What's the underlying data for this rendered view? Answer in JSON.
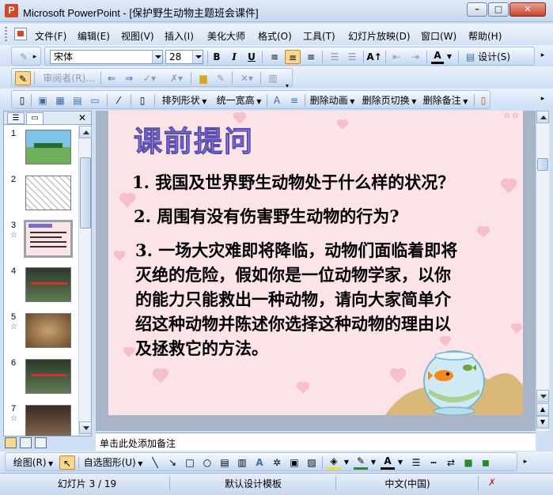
{
  "window": {
    "app_name": "Microsoft PowerPoint",
    "title": "Microsoft PowerPoint - [保护野生动物主题班会课件]",
    "minimize_label": "–",
    "maximize_label": "□",
    "close_label": "✕"
  },
  "menu": {
    "items": [
      "文件(F)",
      "编辑(E)",
      "视图(V)",
      "插入(I)",
      "美化大师",
      "格式(O)",
      "工具(T)",
      "幻灯片放映(D)",
      "窗口(W)",
      "帮助(H)"
    ]
  },
  "formatting": {
    "font_name": "宋体",
    "font_size": "28",
    "bold": "B",
    "italic": "I",
    "underline": "U",
    "design_label": "设计(S)",
    "font_color_label": "A"
  },
  "reviewing": {
    "reviewers_label": "审阅者(R)..."
  },
  "beautify": {
    "arrange_label": "排列形状",
    "uniform_width_label": "统一宽高",
    "delete_anim_label": "删除动画",
    "delete_transition_label": "删除页切换",
    "delete_notes_label": "删除备注"
  },
  "slide_panel": {
    "tab_outline": "outline-icon",
    "tab_slides": "slides-icon",
    "close": "✕",
    "slides": [
      {
        "num": "1",
        "star": ""
      },
      {
        "num": "2",
        "star": ""
      },
      {
        "num": "3",
        "star": "☆"
      },
      {
        "num": "4",
        "star": ""
      },
      {
        "num": "5",
        "star": "☆"
      },
      {
        "num": "6",
        "star": ""
      },
      {
        "num": "7",
        "star": "☆"
      }
    ]
  },
  "slide": {
    "title": "课前提问",
    "q1": "1. 我国及世界野生动物处于什么样的状况？",
    "q2": "2. 周围有没有伤害野生动物的行为?",
    "q3_l1": "3. 一场大灾难即将降临，动物们面临着即将",
    "q3_l2": "灭绝的危险，假如你是一位动物学家，以你",
    "q3_l3": "的能力只能救出一种动物，请向大家简单介",
    "q3_l4": "绍这种动物并陈述你选择这种动物的理由以",
    "q3_l5": "及拯救它的方法。"
  },
  "notes": {
    "placeholder": "单击此处添加备注"
  },
  "drawing": {
    "draw_label": "绘图(R)",
    "autoshapes_label": "自选图形(U)"
  },
  "status": {
    "slide_pos": "幻灯片 3 / 19",
    "template": "默认设计模板",
    "language": "中文(中国)"
  },
  "colors": {
    "slide_bg": "#fce3e8",
    "title_fill": "#c7bff0",
    "title_stroke": "#5a4fb0",
    "highlight": "#fbd68e"
  }
}
